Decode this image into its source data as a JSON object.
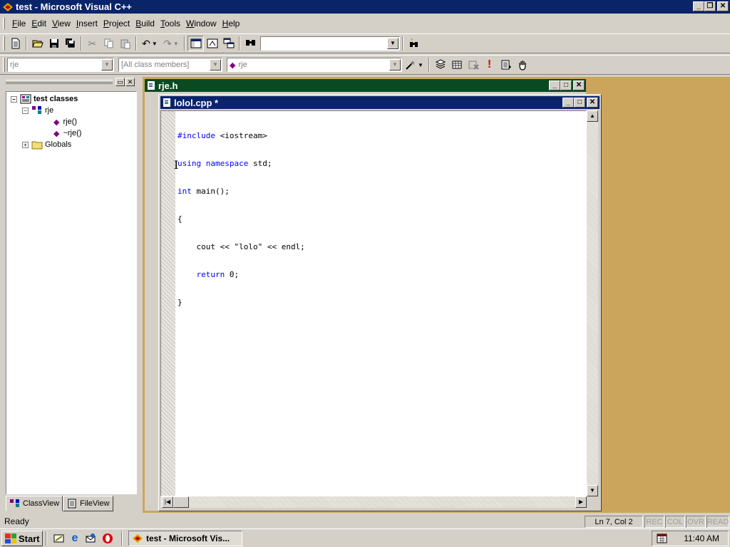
{
  "window": {
    "title": "test - Microsoft Visual C++",
    "min": "_",
    "max": "❐",
    "close": "✕"
  },
  "menu": [
    {
      "label": "File",
      "u": "F",
      "rest": "ile"
    },
    {
      "label": "Edit",
      "u": "E",
      "rest": "dit"
    },
    {
      "label": "View",
      "u": "V",
      "rest": "iew"
    },
    {
      "label": "Insert",
      "u": "I",
      "rest": "nsert"
    },
    {
      "label": "Project",
      "u": "P",
      "rest": "roject"
    },
    {
      "label": "Build",
      "u": "B",
      "rest": "uild"
    },
    {
      "label": "Tools",
      "u": "T",
      "rest": "ools"
    },
    {
      "label": "Window",
      "u": "W",
      "rest": "indow"
    },
    {
      "label": "Help",
      "u": "H",
      "rest": "elp"
    }
  ],
  "toolbar2": {
    "class_combo": "rje",
    "members_combo": "[All class members]",
    "function_combo": "rje"
  },
  "workspace": {
    "tree": {
      "root": "test classes",
      "class": "rje",
      "members": [
        "rje()",
        "~rje()"
      ],
      "globals": "Globals"
    },
    "tabs": [
      "ClassView",
      "FileView"
    ]
  },
  "mdi": {
    "back_window": "rje.h",
    "front_window": "lolol.cpp *",
    "code_lines": [
      {
        "kw": "#include",
        "rest": " <iostream>"
      },
      {
        "kw": "using namespace",
        "rest": " std;"
      },
      {
        "kw": "int",
        "rest": " main();"
      },
      {
        "kw": "",
        "rest": "{"
      },
      {
        "kw": "",
        "rest": "    cout << \"lolo\" << endl;"
      },
      {
        "kw": "    return",
        "rest": " 0;"
      },
      {
        "kw": "",
        "rest": "}"
      }
    ]
  },
  "status": {
    "text": "Ready",
    "position": "Ln 7, Col 2",
    "indicators": [
      "REC",
      "COL",
      "OVR",
      "READ"
    ]
  },
  "taskbar": {
    "start": "Start",
    "task": "test - Microsoft Vis...",
    "clock": "11:40 AM"
  },
  "colors": {
    "titlebar": "#0a246a",
    "mdi_background": "#cca55c",
    "back_window_title": "#0a4a22",
    "keyword": "#0000ff"
  }
}
